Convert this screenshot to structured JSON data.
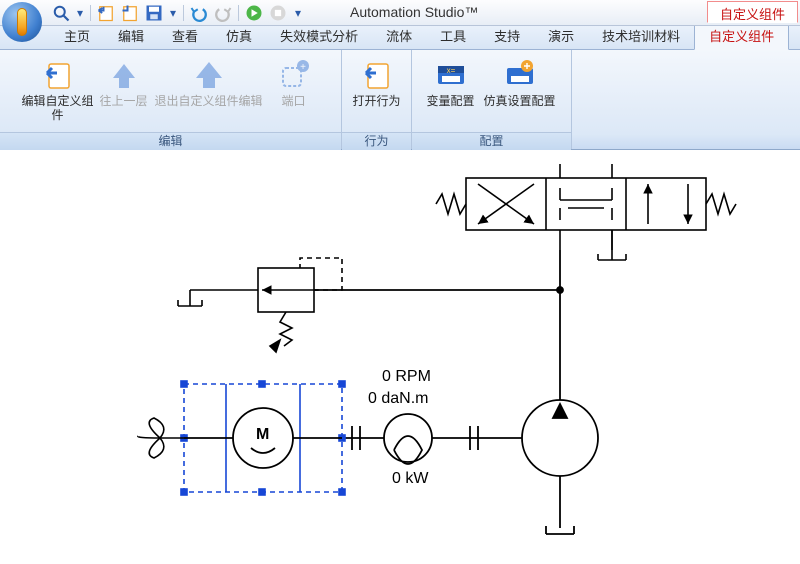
{
  "app": {
    "title": "Automation Studio™"
  },
  "qat": {
    "items": [
      {
        "name": "magnify-icon"
      },
      {
        "name": "dropdown-icon"
      },
      {
        "name": "import1-icon"
      },
      {
        "name": "import2-icon"
      },
      {
        "name": "save-icon"
      },
      {
        "name": "undo-icon"
      },
      {
        "name": "redo-icon"
      },
      {
        "name": "play-icon"
      },
      {
        "name": "stop-icon"
      },
      {
        "name": "more-icon"
      }
    ]
  },
  "title_right_tab": "自定义组件",
  "menuTabs": [
    {
      "label": "主页",
      "active": false
    },
    {
      "label": "编辑",
      "active": false
    },
    {
      "label": "查看",
      "active": false
    },
    {
      "label": "仿真",
      "active": false
    },
    {
      "label": "失效模式分析",
      "active": false
    },
    {
      "label": "流体",
      "active": false
    },
    {
      "label": "工具",
      "active": false
    },
    {
      "label": "支持",
      "active": false
    },
    {
      "label": "演示",
      "active": false
    },
    {
      "label": "技术培训材料",
      "active": false
    },
    {
      "label": "自定义组件",
      "active": true
    }
  ],
  "ribbon": {
    "groups": [
      {
        "label": "编辑",
        "buttons": [
          {
            "name": "edit-custom-component-button",
            "label": "编辑自定义组件",
            "enabled": true,
            "icon": "doc-back"
          },
          {
            "name": "up-one-level-button",
            "label": "往上一层",
            "enabled": false,
            "icon": "arrow-up"
          },
          {
            "name": "exit-edit-button",
            "label": "退出自定义组件编辑",
            "enabled": false,
            "icon": "arrow-up-big"
          },
          {
            "name": "port-button",
            "label": "端口",
            "enabled": false,
            "icon": "port"
          }
        ]
      },
      {
        "label": "行为",
        "buttons": [
          {
            "name": "open-behavior-button",
            "label": "打开行为",
            "enabled": true,
            "icon": "doc-back"
          }
        ]
      },
      {
        "label": "配置",
        "buttons": [
          {
            "name": "variable-config-button",
            "label": "变量配置",
            "enabled": true,
            "icon": "var-drawer"
          },
          {
            "name": "sim-settings-config-button",
            "label": "仿真设置配置",
            "enabled": true,
            "icon": "sim-drawer"
          }
        ]
      }
    ]
  },
  "diagram": {
    "labels": {
      "speed": "0 RPM",
      "torque": "0 daN.m",
      "power": "0 kW",
      "motor": "M"
    }
  }
}
